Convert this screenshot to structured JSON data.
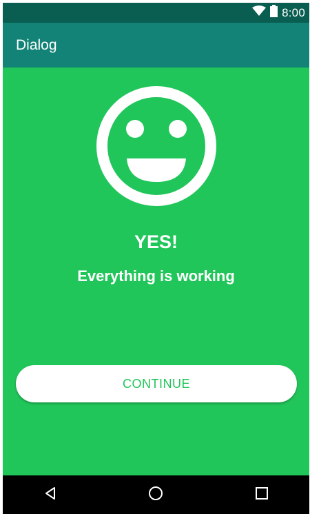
{
  "status_bar": {
    "time": "8:00",
    "icons": [
      "wifi-icon",
      "battery-icon"
    ]
  },
  "app_bar": {
    "title": "Dialog"
  },
  "dialog": {
    "icon": "smiley-face-icon",
    "headline": "YES!",
    "message": "Everything is working",
    "button_label": "CONTINUE"
  },
  "nav_bar": {
    "buttons": [
      "back-icon",
      "home-icon",
      "recents-icon"
    ]
  },
  "colors": {
    "background": "#21c65a",
    "status_bar": "#0a5e51",
    "app_bar": "#138377",
    "button": "#ffffff",
    "button_text": "#21c65a",
    "nav_bar": "#000000"
  }
}
